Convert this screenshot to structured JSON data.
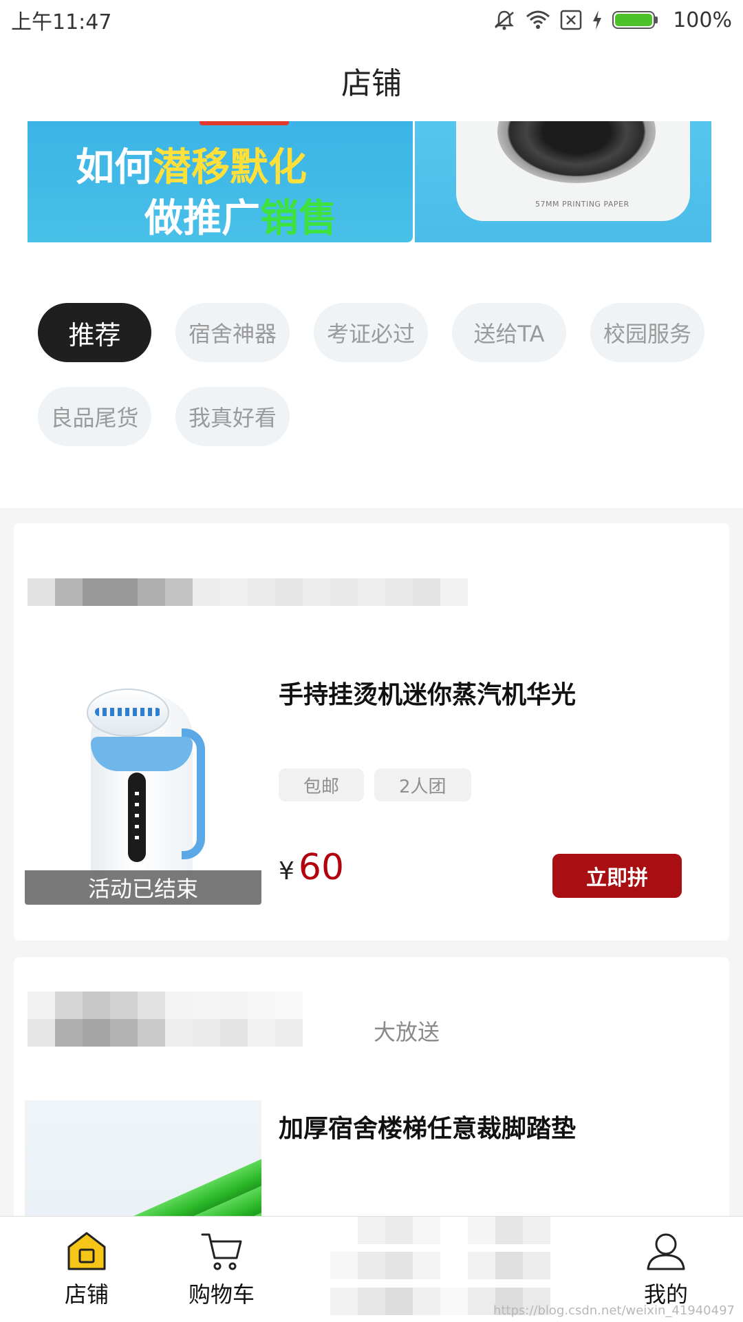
{
  "status_bar": {
    "time": "上午11:47",
    "battery_percent": "100%",
    "icons": [
      "mute-icon",
      "wifi-icon",
      "sim-icon",
      "charging-icon",
      "battery-icon"
    ]
  },
  "header": {
    "title": "店铺"
  },
  "banner": {
    "line1_a": "如何",
    "line1_b": "潜移默化",
    "line2_a": "做推广",
    "line2_b": "销售",
    "device_text": "57MM PRINTING PAPER"
  },
  "categories": {
    "items": [
      "推荐",
      "宿舍神器",
      "考证必过",
      "送给TA",
      "校园服务",
      "良品尾货",
      "我真好看"
    ],
    "active": "推荐"
  },
  "products": [
    {
      "title": "手持挂烫机迷你蒸汽机华光",
      "tags": [
        "包邮",
        "2人团"
      ],
      "price_symbol": "¥",
      "price": "60",
      "status_overlay": "活动已结束",
      "button": "立即拼"
    },
    {
      "header_text": "大放送",
      "title": "加厚宿舍楼梯任意裁脚踏垫"
    }
  ],
  "bottom_nav": {
    "items": [
      {
        "label": "店铺",
        "icon": "shop-icon",
        "active": true
      },
      {
        "label": "购物车",
        "icon": "cart-icon",
        "active": false
      },
      {
        "label": "我的",
        "icon": "profile-icon",
        "active": false
      }
    ]
  },
  "watermark": "https://blog.csdn.net/weixin_41940497",
  "colors": {
    "accent": "#a80e12",
    "price": "#b3000d",
    "chip_bg": "#eff3f6",
    "chip_active_bg": "#1f1f1f",
    "nav_active": "#f5c518"
  }
}
